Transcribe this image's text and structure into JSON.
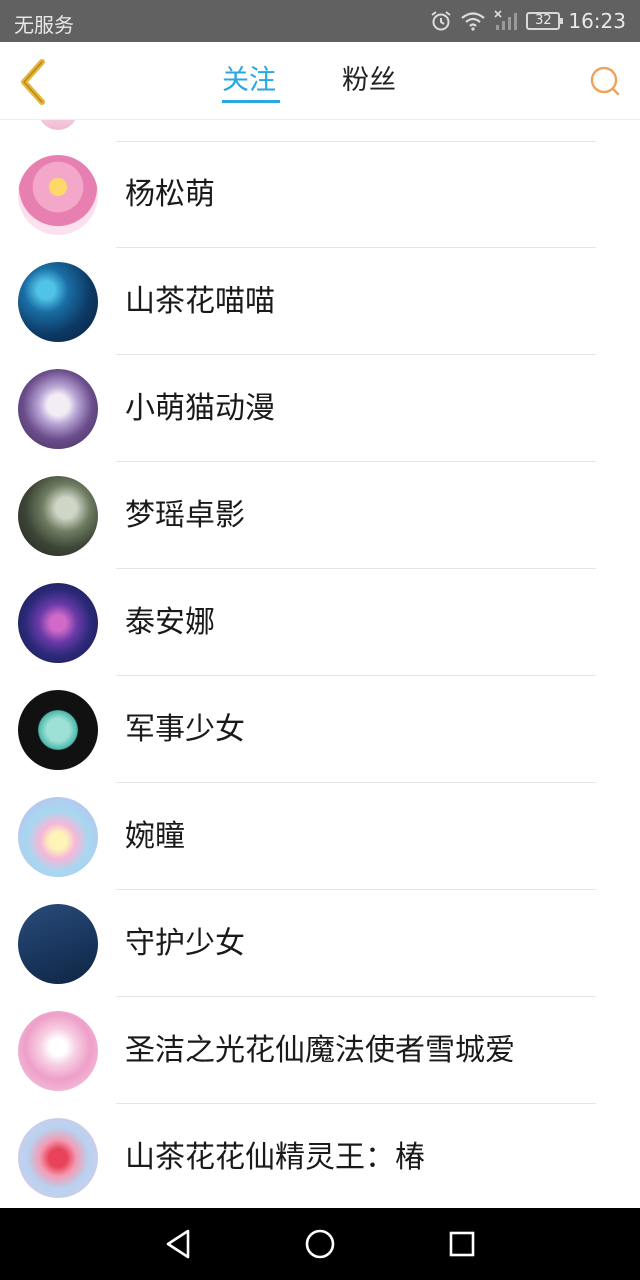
{
  "status_bar": {
    "carrier": "无服务",
    "battery": "32",
    "time": "16:23",
    "icons": [
      "alarm-icon",
      "wifi-icon",
      "signal-icon",
      "battery-icon"
    ]
  },
  "header": {
    "back_icon": "chevron-left-icon",
    "tabs": [
      {
        "label": "关注",
        "active": true
      },
      {
        "label": "粉丝",
        "active": false
      }
    ],
    "search_icon": "search-icon"
  },
  "colors": {
    "accent": "#29a7e1",
    "back_arrow": "#e6b53a",
    "search": "#f0a15a",
    "status_bar": "#616161",
    "nav_bar": "#000000"
  },
  "follow_list": [
    {
      "name": "杨松萌"
    },
    {
      "name": "山茶花喵喵"
    },
    {
      "name": "小萌猫动漫"
    },
    {
      "name": "梦瑶卓影"
    },
    {
      "name": "泰安娜"
    },
    {
      "name": "军事少女"
    },
    {
      "name": "婉瞳"
    },
    {
      "name": "守护少女"
    },
    {
      "name": "圣洁之光花仙魔法使者雪城爱"
    },
    {
      "name": "山茶花花仙精灵王：椿"
    }
  ],
  "nav_bar": {
    "icons": [
      "back-triangle-icon",
      "home-circle-icon",
      "recents-square-icon"
    ]
  }
}
